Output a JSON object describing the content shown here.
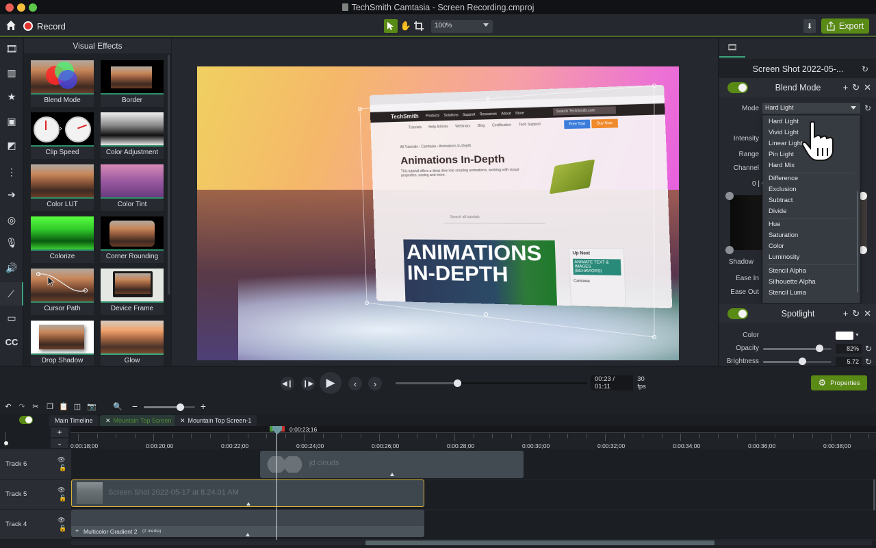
{
  "window": {
    "title": "TechSmith Camtasia - Screen Recording.cmproj",
    "traffic_lights": {
      "close": "#ec5f56",
      "minimize": "#f5be3b",
      "maximize": "#5dc84a"
    }
  },
  "toolbar": {
    "record_label": "Record",
    "zoom_value": "100%",
    "export_label": "Export",
    "tools": [
      "select-arrow",
      "hand-pan",
      "crop"
    ]
  },
  "colors": {
    "accent_green": "#5a8a16",
    "selection_teal": "#3aa37d",
    "clip_selected_border": "#d8b43a",
    "record_red": "#e0312d"
  },
  "left_rail": {
    "items": [
      "media-bin",
      "library",
      "favorites",
      "annotations",
      "transitions",
      "behaviors",
      "animations",
      "cursor-effects",
      "voice-narration",
      "audio-effects",
      "visual-effects",
      "interactivity",
      "captions"
    ],
    "active": "visual-effects",
    "captions_label": "CC"
  },
  "effects_panel": {
    "title": "Visual Effects",
    "items": [
      {
        "label": "Blend Mode"
      },
      {
        "label": "Border"
      },
      {
        "label": "Clip Speed"
      },
      {
        "label": "Color Adjustment"
      },
      {
        "label": "Color LUT"
      },
      {
        "label": "Color Tint"
      },
      {
        "label": "Colorize"
      },
      {
        "label": "Corner Rounding"
      },
      {
        "label": "Cursor Path"
      },
      {
        "label": "Device Frame"
      },
      {
        "label": "Drop Shadow"
      },
      {
        "label": "Glow"
      }
    ]
  },
  "preview": {
    "browser": {
      "brand": "TechSmith",
      "nav_links": [
        "Products",
        "Solutions",
        "Support",
        "Resources",
        "About",
        "Store"
      ],
      "search_placeholder": "Search TechSmith.com",
      "free_trial": "Free Trial",
      "buy_now": "Buy Now",
      "sub_links": [
        "Tutorials",
        "Help Articles",
        "Webinars",
        "Blog",
        "Certification",
        "Tech Support"
      ],
      "breadcrumb": "All Tutorials › Camtasia › Animations In-Depth",
      "heading": "Animations In-Depth",
      "description": "This tutorial offers a deep dive into creating animations, working with visual properties, easing and more.",
      "search_tutorials": "Search all tutorials",
      "hero_text": "ANIMATIONS IN-DEPTH",
      "up_next_title": "Up Next",
      "up_next_card": "ANIMATE TEXT & IMAGES (BEHAVIORS)",
      "up_next_meta": "Camtasia"
    }
  },
  "properties": {
    "media_name": "Screen Shot 2022-05-...",
    "blend_mode": {
      "title": "Blend Mode",
      "enabled": true,
      "mode_label": "Mode",
      "mode_value": "Hard Light",
      "intensity_label": "Intensity",
      "range_label": "Range",
      "channel_label": "Channel",
      "range_readout": "0 | C",
      "shadow_label": "Shadow",
      "ease_in_label": "Ease In",
      "ease_out_label": "Ease Out",
      "dropdown_groups": [
        [
          "Hard Light",
          "Vivid Light",
          "Linear Light",
          "Pin Light",
          "Hard Mix"
        ],
        [
          "Difference",
          "Exclusion",
          "Subtract",
          "Divide"
        ],
        [
          "Hue",
          "Saturation",
          "Color",
          "Luminosity"
        ],
        [
          "Stencil Alpha",
          "Silhouette Alpha",
          "Stencil Luma"
        ]
      ]
    },
    "spotlight": {
      "title": "Spotlight",
      "enabled": true,
      "color_label": "Color",
      "color_value": "#ffffff",
      "opacity_label": "Opacity",
      "opacity_value": "82%",
      "opacity_fraction": 0.82,
      "brightness_label": "Brightness",
      "brightness_value": "5.72",
      "brightness_fraction": 0.57
    }
  },
  "transport": {
    "current_time": "00:23",
    "total_time": "01:11",
    "time_display": "00:23 / 01:11",
    "fps": "30 fps",
    "scrub_fraction": 0.32,
    "properties_label": "Properties"
  },
  "timeline": {
    "zoom_fraction": 0.7,
    "tabs": [
      {
        "label": "Main Timeline",
        "closable": false,
        "active": false
      },
      {
        "label": "Mountain Top Screen",
        "closable": true,
        "active": true
      },
      {
        "label": "Mountain Top Screen-1",
        "closable": true,
        "active": false
      }
    ],
    "playhead_time": "0:00:23;16",
    "ruler_labels": [
      "0:00:18;00",
      "0:00:20;00",
      "0:00:22;00",
      "0:00:24;00",
      "0:00:26;00",
      "0:00:28;00",
      "0:00:30;00",
      "0:00:32;00",
      "0:00:34;00",
      "0:00:36;00",
      "0:00:38;00"
    ],
    "tracks": [
      {
        "name": "Track 6",
        "clips": [
          {
            "label": "jd clouds"
          }
        ]
      },
      {
        "name": "Track 5",
        "clips": [
          {
            "label": "Screen Shot 2022-05-17 at 8.24.01 AM",
            "selected": true
          }
        ]
      },
      {
        "name": "Track 4",
        "clips": [
          {
            "label": "Multicolor Gradient 2",
            "badge": "(2 media)"
          }
        ]
      }
    ]
  }
}
